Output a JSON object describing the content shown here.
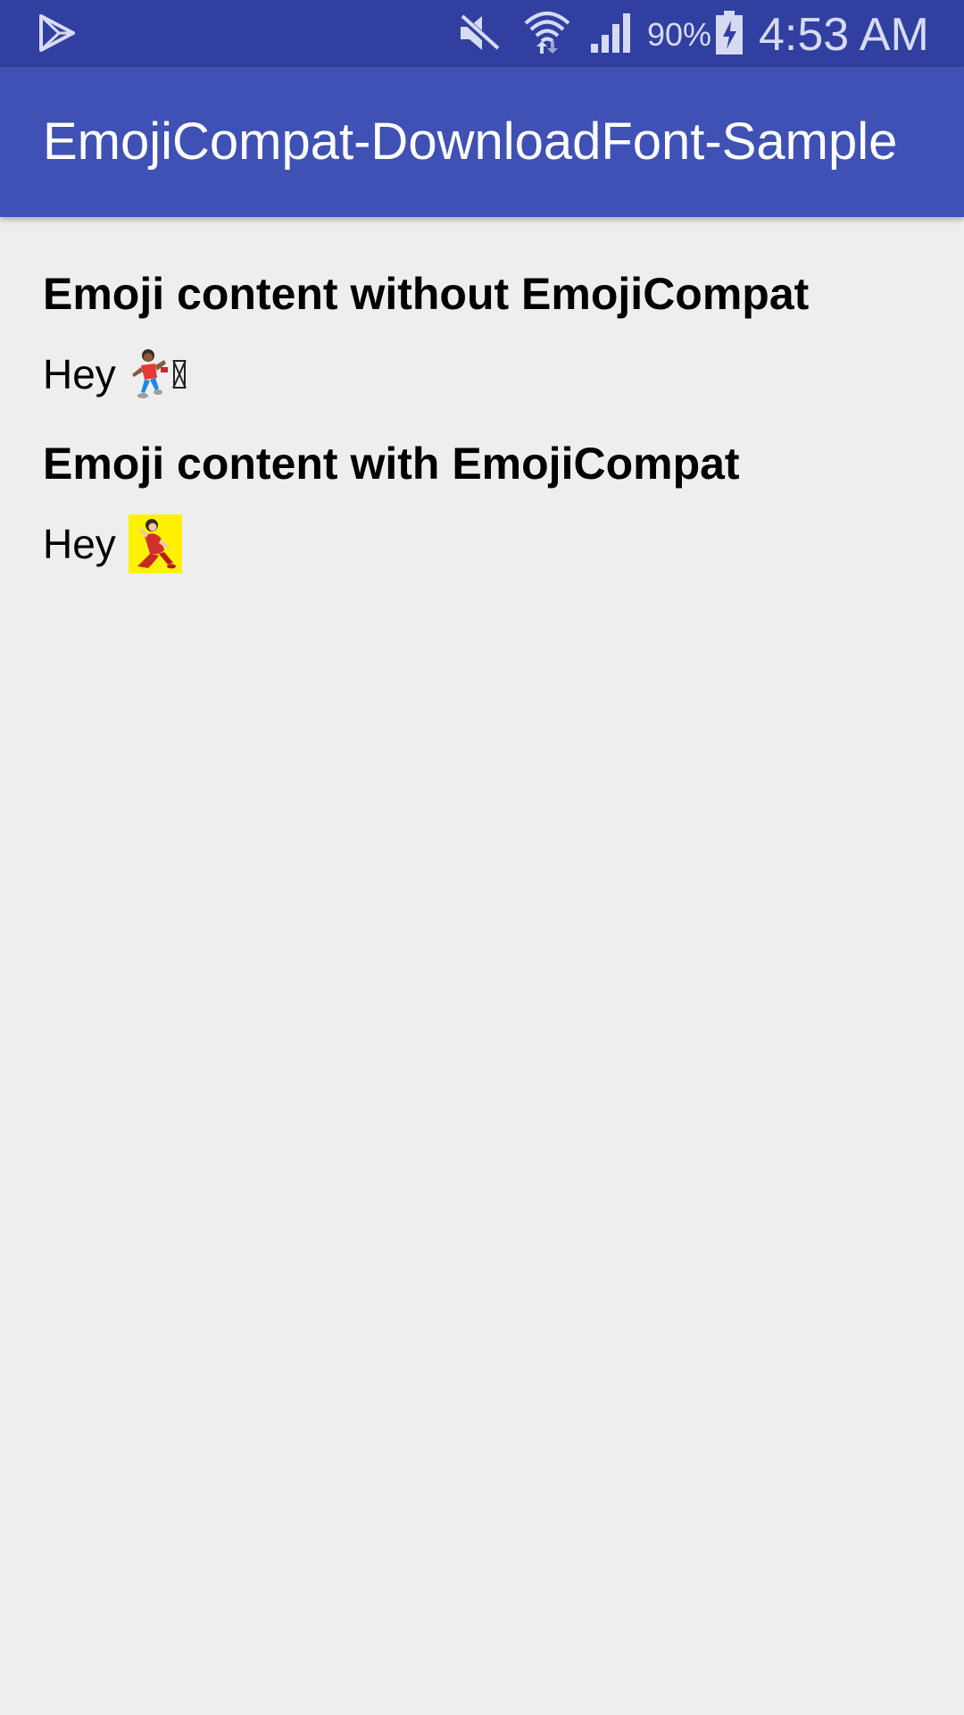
{
  "status_bar": {
    "battery_percent": "90%",
    "time": "4:53 AM",
    "icons": [
      "play-store-icon",
      "mute-icon",
      "wifi-icon",
      "signal-icon",
      "battery-charging-icon"
    ]
  },
  "app_bar": {
    "title": "EmojiCompat-DownloadFont-Sample",
    "color": "#3f51b5"
  },
  "sections": [
    {
      "heading": "Emoji content without EmojiCompat",
      "text": "Hey",
      "emoji": "dancer-emoji-native",
      "has_missing_glyph": true
    },
    {
      "heading": "Emoji content with EmojiCompat",
      "text": "Hey",
      "emoji": "dancer-emoji-compat",
      "has_missing_glyph": false
    }
  ],
  "colors": {
    "status_bar": "#3140a0",
    "background": "#eeeeef",
    "emoji_compat_background": "#fff200"
  }
}
